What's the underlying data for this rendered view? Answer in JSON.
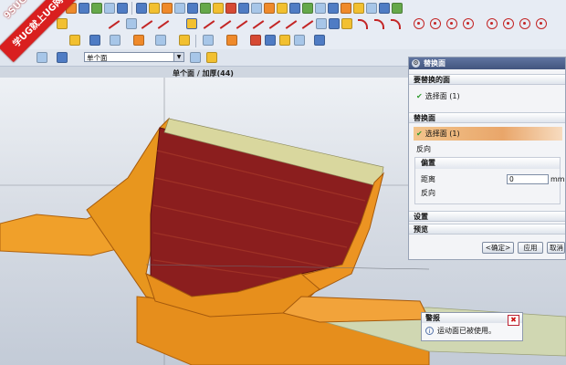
{
  "watermark": {
    "line1": "学UG就上UG网",
    "line2": "9SUG"
  },
  "selection_bar": {
    "filter_value": "单个面"
  },
  "status_line": "单个面 / 加厚(44)",
  "dialog": {
    "title": "替换面",
    "section_target": "要替换的面",
    "target_select": "选择面 (1)",
    "section_replace": "替换面",
    "replace_select": "选择面 (1)",
    "reverse_label": "反向",
    "offset_group": "偏置",
    "distance_label": "距离",
    "distance_value": "0",
    "distance_unit": "mm",
    "offset_reverse": "反向",
    "settings": "设置",
    "preview": "预览",
    "ok": "<确定>",
    "apply": "应用",
    "cancel": "取消"
  },
  "alert": {
    "title": "警报",
    "message": "运动面已被使用。"
  },
  "colors": {
    "accent": "#f29a1f",
    "face_highlight": "#8b1e1e",
    "selected_face": "#e9a66a"
  },
  "icons": [
    "sketch-icon",
    "line-icon",
    "arc-icon",
    "circle-icon",
    "trim-icon",
    "extrude-icon",
    "hole-icon",
    "measure-icon",
    "close-icon",
    "info-icon"
  ]
}
